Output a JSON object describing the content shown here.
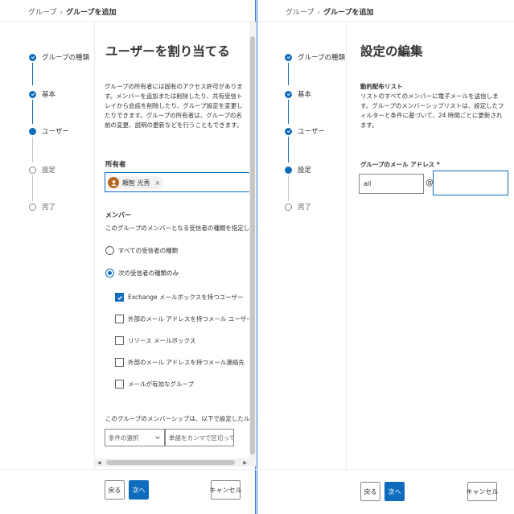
{
  "left": {
    "breadcrumb": {
      "parent": "グループ",
      "current": "グループを追加"
    },
    "steps": [
      {
        "label": "グループの種類",
        "state": "done"
      },
      {
        "label": "基本",
        "state": "done"
      },
      {
        "label": "ユーザー",
        "state": "current"
      },
      {
        "label": "設定",
        "state": "future"
      },
      {
        "label": "完了",
        "state": "future"
      }
    ],
    "title": "ユーザーを割り当てる",
    "description": "グループの所有者には固有のアクセス許可があります。メンバーを追加または削除したり、共有受信トレイから会話を削除したり、グループ設定を変更したりできます。グループの所有者は、グループの名前の変更、説明の更新などを行うこともできます。",
    "owners": {
      "label": "所有者",
      "chips": [
        {
          "name": "頼智 光秀",
          "remove": "×"
        }
      ]
    },
    "members": {
      "label": "メンバー",
      "description": "このグループのメンバーとなる受信者の種類を指定します。",
      "radios": [
        {
          "label": "すべての受信者の種類",
          "selected": false
        },
        {
          "label": "次の受信者の種類のみ",
          "selected": true
        }
      ],
      "checkboxes": [
        {
          "label": "Exchange メールボックスを持つユーザー",
          "checked": true
        },
        {
          "label": "外部のメール アドレスを持つメール ユーザー",
          "checked": false
        },
        {
          "label": "リソース メールボックス",
          "checked": false
        },
        {
          "label": "外部のメール アドレスを持つメール連絡先",
          "checked": false
        },
        {
          "label": "メールが有効なグループ",
          "checked": false
        }
      ]
    },
    "rules": {
      "text": "このグループのメンバーシップは、以下で設定したルールによって決定されます",
      "condition_placeholder": "条件の選択",
      "value_placeholder": "単語をカンマで区切って入力してく..."
    },
    "footer": {
      "back": "戻る",
      "next": "次へ",
      "cancel": "キャンセル"
    }
  },
  "right": {
    "breadcrumb": {
      "parent": "グループ",
      "current": "グループを追加"
    },
    "steps": [
      {
        "label": "グループの種類",
        "state": "done"
      },
      {
        "label": "基本",
        "state": "done"
      },
      {
        "label": "ユーザー",
        "state": "done"
      },
      {
        "label": "設定",
        "state": "current"
      },
      {
        "label": "完了",
        "state": "future"
      }
    ],
    "title": "設定の編集",
    "list_type_label": "動的配布リスト",
    "list_description": "リストのすべてのメンバーに電子メールを送信します。グループのメンバーシップリストは、設定したフィルターと条件に基づいて、24 時間ごとに更新されます。",
    "email": {
      "label": "グループのメール アドレス *",
      "alias_value": "all",
      "at": "@",
      "domain_value": ""
    },
    "footer": {
      "back": "戻る",
      "next": "次へ",
      "cancel": "キャンセル"
    }
  },
  "colors": {
    "accent": "#0f6cbd",
    "panel_border": "#2f6fdd",
    "avatar": "#b46a23"
  }
}
